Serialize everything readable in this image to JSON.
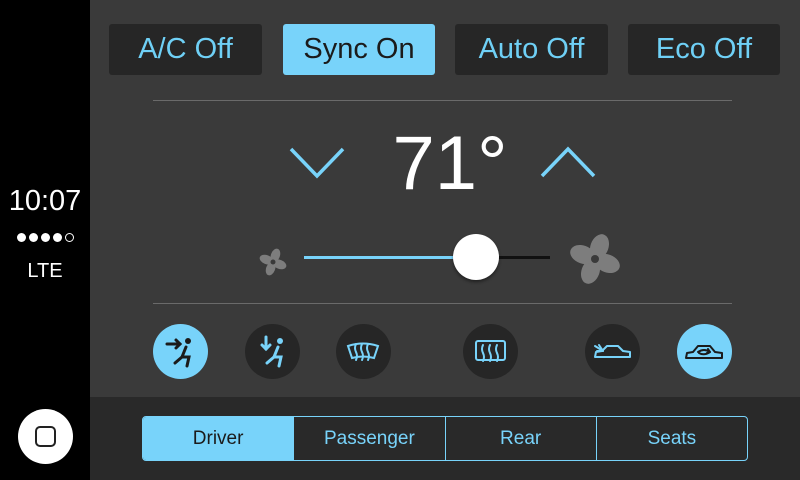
{
  "status": {
    "time": "10:07",
    "network": "LTE",
    "signal_bars": 4,
    "signal_max": 5
  },
  "toggles": [
    {
      "label": "A/C Off",
      "active": false
    },
    {
      "label": "Sync On",
      "active": true
    },
    {
      "label": "Auto Off",
      "active": false
    },
    {
      "label": "Eco Off",
      "active": false
    }
  ],
  "temperature": {
    "value": "71°",
    "decrease_icon": "chevron-down-icon",
    "increase_icon": "chevron-up-icon"
  },
  "fan": {
    "level": 0.7,
    "low_icon": "fan-small-icon",
    "high_icon": "fan-large-icon"
  },
  "vents": [
    {
      "icon": "airflow-face-icon",
      "active": true
    },
    {
      "icon": "airflow-feet-icon",
      "active": false
    },
    {
      "icon": "front-defrost-icon",
      "active": false
    },
    {
      "icon": "rear-defrost-icon",
      "active": false
    },
    {
      "icon": "fresh-air-icon",
      "active": false
    },
    {
      "icon": "recirculate-icon",
      "active": true
    }
  ],
  "zones": [
    {
      "label": "Driver",
      "active": true
    },
    {
      "label": "Passenger",
      "active": false
    },
    {
      "label": "Rear",
      "active": false
    },
    {
      "label": "Seats",
      "active": false
    }
  ],
  "colors": {
    "accent": "#78d3fa",
    "panel": "#3a3a3a",
    "button": "#262626"
  }
}
